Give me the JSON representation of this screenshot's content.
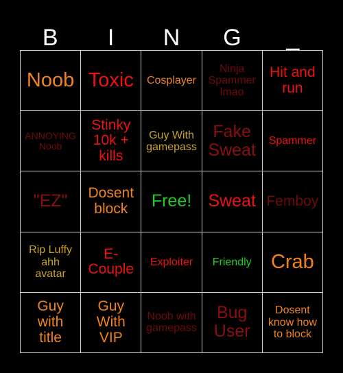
{
  "card": {
    "title": "BINGO Card",
    "background_color": "#000000",
    "grid_line_color": "#cfcfcf",
    "header": {
      "letters": [
        "B",
        "I",
        "N",
        "G",
        "_"
      ],
      "color": "#ffffff"
    },
    "palette": {
      "orange": "#f0831e",
      "gold": "#c9a227",
      "red": "#ee1111",
      "dark_red": "#8b0f0f",
      "deep_red": "#6e0a0a",
      "green": "#22cc22",
      "white": "#ffffff"
    },
    "rows": 5,
    "columns": 5,
    "cells": [
      [
        {
          "text": "Noob",
          "color_name": "orange",
          "size": "xl"
        },
        {
          "text": "Toxic",
          "color_name": "red",
          "size": "xl"
        },
        {
          "text": "Cosplayer",
          "color_name": "orange",
          "size": "sm"
        },
        {
          "text": "Ninja\nSpammer\nlmao",
          "color_name": "deep_red",
          "size": "sm"
        },
        {
          "text": "Hit and\nrun",
          "color_name": "red",
          "size": "md"
        }
      ],
      [
        {
          "text": "ANNOYING\nNoob",
          "color_name": "deep_red",
          "size": "xs"
        },
        {
          "text": "Stinky\n10k +\nkills",
          "color_name": "red",
          "size": "md"
        },
        {
          "text": "Guy With\ngamepass",
          "color_name": "gold",
          "size": "sm"
        },
        {
          "text": "Fake\nSweat",
          "color_name": "dark_red",
          "size": "lg"
        },
        {
          "text": "Spammer",
          "color_name": "red",
          "size": "sm"
        }
      ],
      [
        {
          "text": "\"EZ\"",
          "color_name": "dark_red",
          "size": "lg"
        },
        {
          "text": "Dosent\nblock",
          "color_name": "orange",
          "size": "md"
        },
        {
          "text": "Free!",
          "color_name": "green",
          "size": "lg"
        },
        {
          "text": "Sweat",
          "color_name": "red",
          "size": "lg"
        },
        {
          "text": "Femboy",
          "color_name": "deep_red",
          "size": "md"
        }
      ],
      [
        {
          "text": "Rip Luffy\nahh\navatar",
          "color_name": "gold",
          "size": "sm"
        },
        {
          "text": "E-\nCouple",
          "color_name": "red",
          "size": "md"
        },
        {
          "text": "Exploiter",
          "color_name": "red",
          "size": "sm"
        },
        {
          "text": "Friendly",
          "color_name": "green",
          "size": "sm"
        },
        {
          "text": "Crab",
          "color_name": "orange",
          "size": "xl"
        }
      ],
      [
        {
          "text": "Guy\nwith\ntitle",
          "color_name": "orange",
          "size": "md"
        },
        {
          "text": "Guy\nWith\nVIP",
          "color_name": "orange",
          "size": "md"
        },
        {
          "text": "Noob with\ngamepass",
          "color_name": "deep_red",
          "size": "sm"
        },
        {
          "text": "Bug\nUser",
          "color_name": "dark_red",
          "size": "lg"
        },
        {
          "text": "Dosent\nknow how\nto block",
          "color_name": "orange",
          "size": "sm"
        }
      ]
    ]
  }
}
